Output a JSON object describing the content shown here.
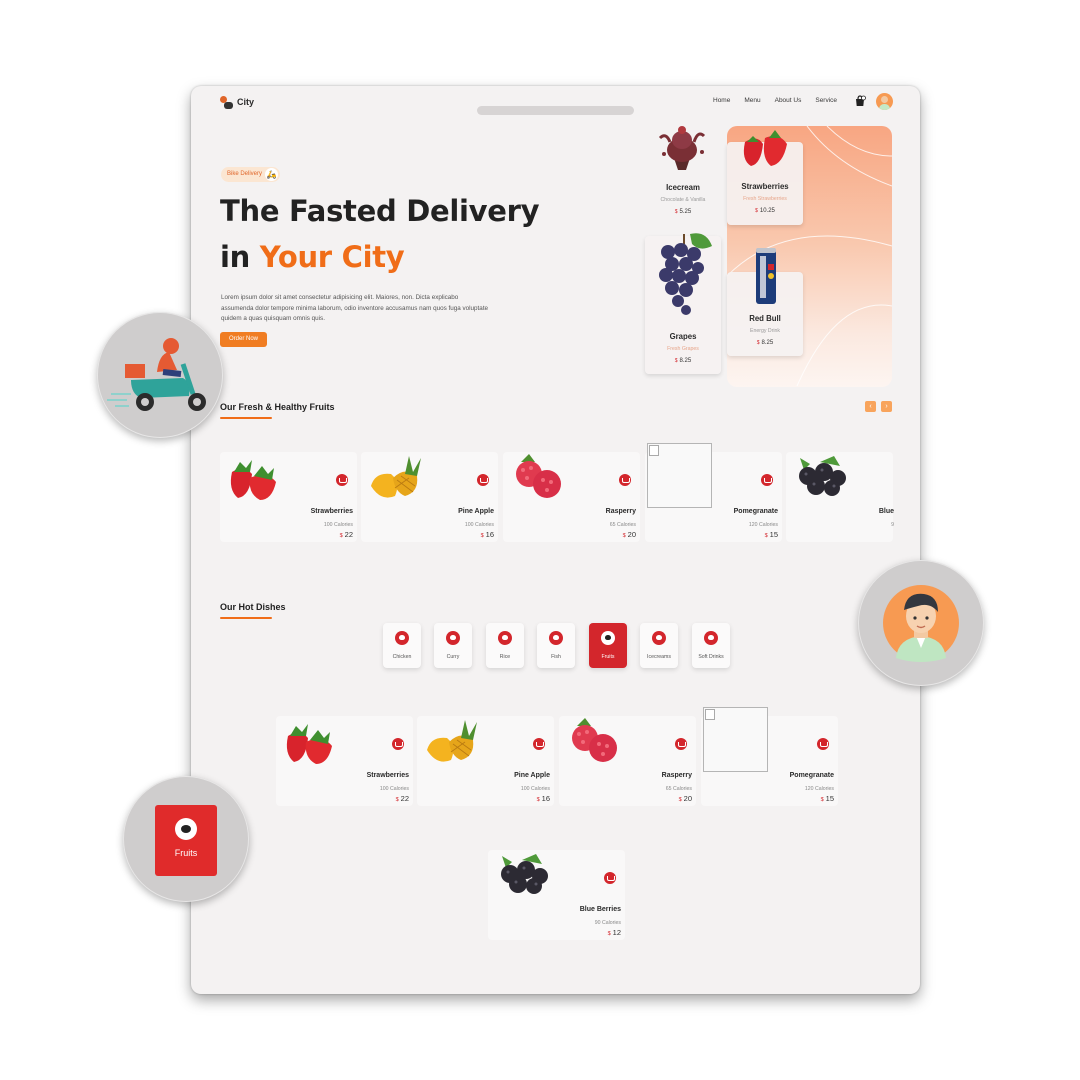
{
  "header": {
    "logo_text": "City",
    "nav": [
      "Home",
      "Menu",
      "About Us",
      "Service"
    ]
  },
  "hero": {
    "badge": "Bike Delivery",
    "title_line1": "The Fasted Delivery",
    "title_line2_prefix": "in ",
    "title_line2_accent": "Your City",
    "description": "Lorem ipsum dolor sit amet consectetur adipisicing elit. Maiores, non. Dicta explicabo assumenda dolor tempore minima laborum, odio inventore accusamus nam quos fuga voluptate quidem a quas quisquam omnis quis.",
    "cta": "Order Now"
  },
  "hero_cards": [
    {
      "name": "Icecream",
      "sub": "Chocolate & Vanilla",
      "currency": "$",
      "price": "5.25"
    },
    {
      "name": "Strawberries",
      "sub": "Fresh Strawberries",
      "currency": "$",
      "price": "10.25"
    },
    {
      "name": "Grapes",
      "sub": "Fresh Grapes",
      "currency": "$",
      "price": "8.25"
    },
    {
      "name": "Red Bull",
      "sub": "Energy Drink",
      "currency": "$",
      "price": "8.25"
    }
  ],
  "fruits_section": {
    "title": "Our Fresh & Healthy Fruits",
    "prev": "‹",
    "next": "›",
    "items": [
      {
        "name": "Strawberries",
        "calories": "100 Calories",
        "currency": "$",
        "price": "22"
      },
      {
        "name": "Pine Apple",
        "calories": "100 Calories",
        "currency": "$",
        "price": "16"
      },
      {
        "name": "Rasperry",
        "calories": "65 Calories",
        "currency": "$",
        "price": "20"
      },
      {
        "name": "Pomegranate",
        "calories": "120 Calories",
        "currency": "$",
        "price": "15"
      },
      {
        "name": "Blue",
        "calories": "9",
        "currency": "",
        "price": ""
      }
    ]
  },
  "dishes_section": {
    "title": "Our Hot Dishes",
    "categories": [
      "Chicken",
      "Curry",
      "Rice",
      "Fish",
      "Fruits",
      "Icecreams",
      "Soft Drinks"
    ],
    "active_category": "Fruits",
    "items": [
      {
        "name": "Strawberries",
        "calories": "100 Calories",
        "currency": "$",
        "price": "22"
      },
      {
        "name": "Pine Apple",
        "calories": "100 Calories",
        "currency": "$",
        "price": "16"
      },
      {
        "name": "Rasperry",
        "calories": "65 Calories",
        "currency": "$",
        "price": "20"
      },
      {
        "name": "Pomegranate",
        "calories": "120 Calories",
        "currency": "$",
        "price": "15"
      },
      {
        "name": "Blue Berries",
        "calories": "90 Calories",
        "currency": "$",
        "price": "12"
      }
    ]
  },
  "floating": {
    "fruits_label": "Fruits"
  },
  "colors": {
    "accent_orange": "#f06d18",
    "accent_red": "#d3262c",
    "frame_bg": "#f4f2f2"
  }
}
